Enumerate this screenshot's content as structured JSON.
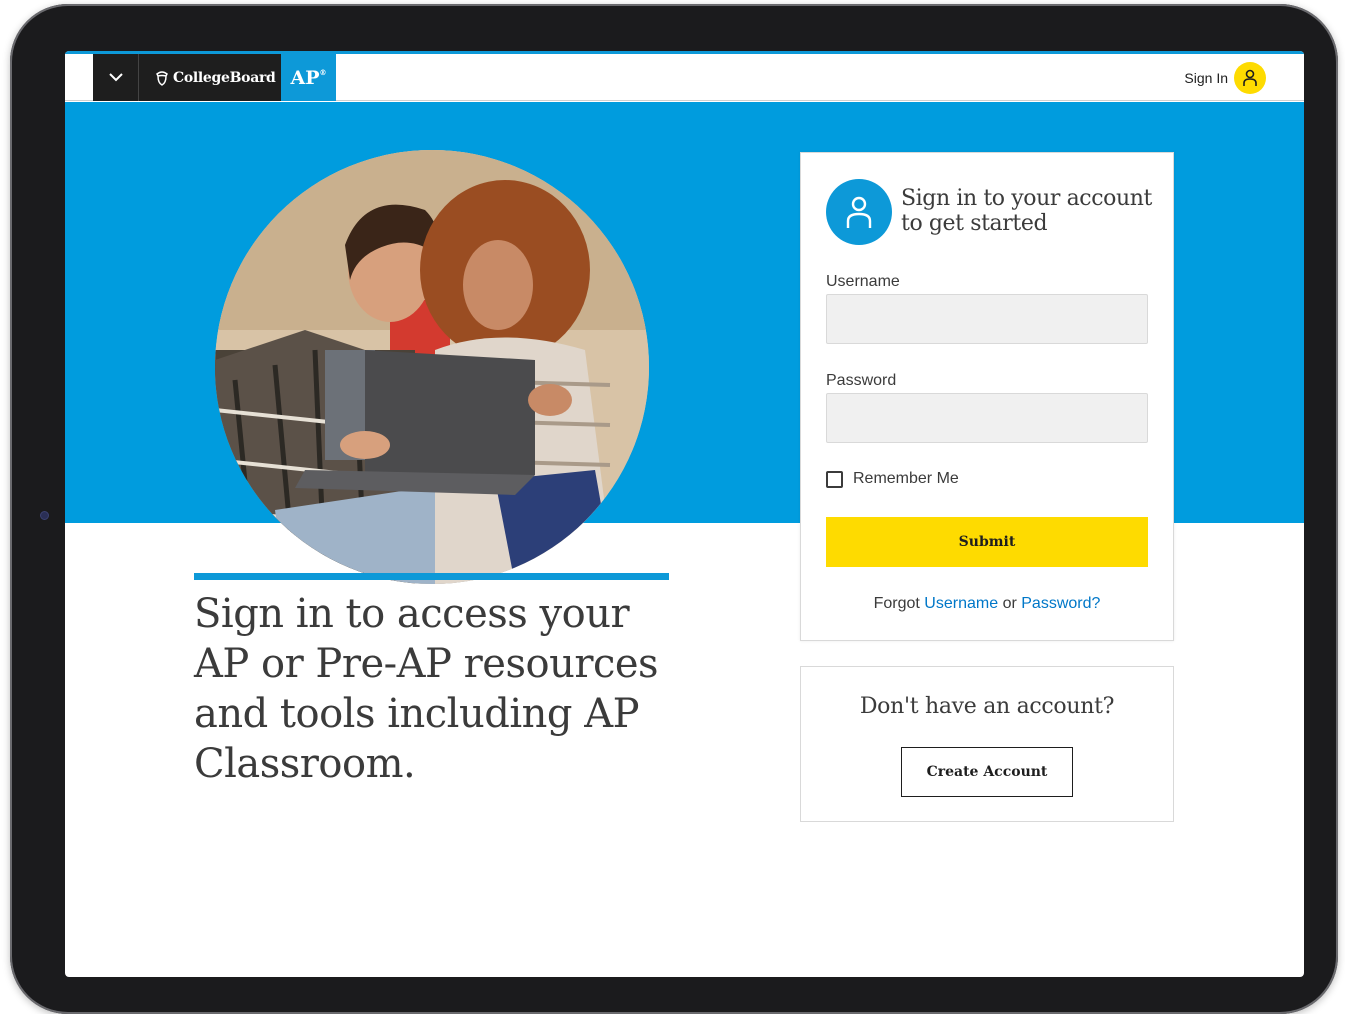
{
  "header": {
    "menu_icon": "chevron-down-icon",
    "brand_logo": "CollegeBoard",
    "ap_badge": "AP",
    "signin_label": "Sign In",
    "signin_icon": "user-icon"
  },
  "hero": {
    "photo": "two-students-with-laptop"
  },
  "headline": "Sign in to access your AP or Pre-AP resources and tools including AP Classroom.",
  "signin_card": {
    "avatar_icon": "user-icon",
    "title": "Sign in to your account to get started",
    "username_label": "Username",
    "username_value": "",
    "password_label": "Password",
    "password_value": "",
    "remember_label": "Remember Me",
    "submit_label": "Submit",
    "forgot_prefix": "Forgot",
    "forgot_username": "Username",
    "forgot_or": "or",
    "forgot_password": "Password",
    "forgot_suffix": "?"
  },
  "create_card": {
    "title": "Don't have an account?",
    "button_label": "Create Account"
  },
  "colors": {
    "brand_blue": "#009cde",
    "accent_yellow": "#fedb00",
    "dark": "#1e1e1e",
    "link_blue": "#0077c8"
  }
}
